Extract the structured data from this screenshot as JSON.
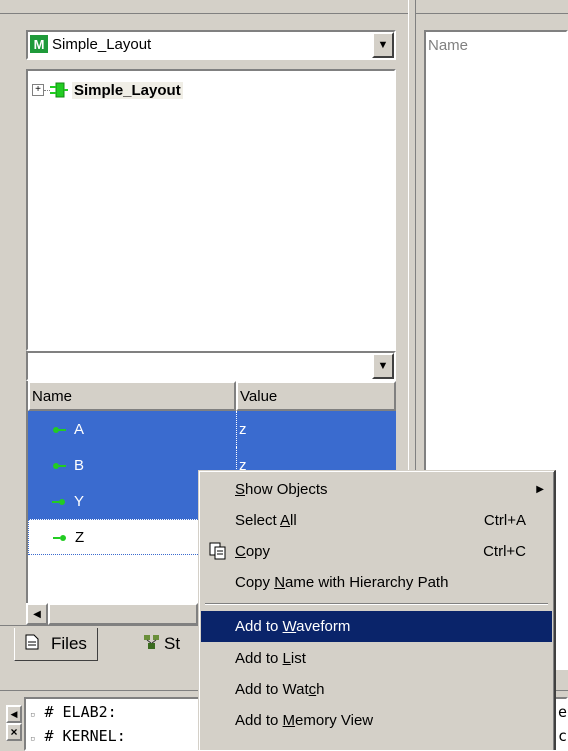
{
  "left_panel": {
    "design_selector": {
      "value": "Simple_Layout",
      "icon": "module-m-icon"
    },
    "tree_root": {
      "label": "Simple_Layout",
      "expander": "+"
    },
    "filter_selector": {
      "value": ""
    },
    "table": {
      "columns": [
        "Name",
        "Value"
      ],
      "rows": [
        {
          "name": "A",
          "value": "z",
          "selected": true
        },
        {
          "name": "B",
          "value": "z",
          "selected": true
        },
        {
          "name": "Y",
          "value": "",
          "selected": true
        },
        {
          "name": "Z",
          "value": "",
          "selected": false
        }
      ]
    },
    "tabs": [
      {
        "label": "Files",
        "icon": "document-icon"
      },
      {
        "label": "St",
        "icon": "structure-icon"
      }
    ]
  },
  "right_panel": {
    "column_header": "Name"
  },
  "console": {
    "lines": [
      "# ELAB2:",
      "# KERNEL:"
    ],
    "right_fragments": [
      "e",
      "c"
    ]
  },
  "context_menu": {
    "items": [
      {
        "label_pre": "",
        "label_u": "S",
        "label_post": "how Objects",
        "shortcut": "",
        "submenu": true
      },
      {
        "label_pre": "Select ",
        "label_u": "A",
        "label_post": "ll",
        "shortcut": "Ctrl+A"
      },
      {
        "label_pre": "",
        "label_u": "C",
        "label_post": "opy",
        "shortcut": "Ctrl+C",
        "icon": "copy-icon"
      },
      {
        "label_pre": "Copy ",
        "label_u": "N",
        "label_post": "ame with Hierarchy Path",
        "shortcut": ""
      },
      {
        "label_pre": "Add to ",
        "label_u": "W",
        "label_post": "aveform",
        "shortcut": "",
        "highlighted": true
      },
      {
        "label_pre": "Add to ",
        "label_u": "L",
        "label_post": "ist",
        "shortcut": ""
      },
      {
        "label_pre": "Add to Wat",
        "label_u": "c",
        "label_post": "h",
        "shortcut": ""
      },
      {
        "label_pre": "Add to ",
        "label_u": "M",
        "label_post": "emory View",
        "shortcut": ""
      }
    ]
  },
  "colors": {
    "selection": "#3a6bcf",
    "menu_highlight": "#0a246a",
    "face": "#d4d0c8",
    "signal_green": "#22cc22"
  }
}
